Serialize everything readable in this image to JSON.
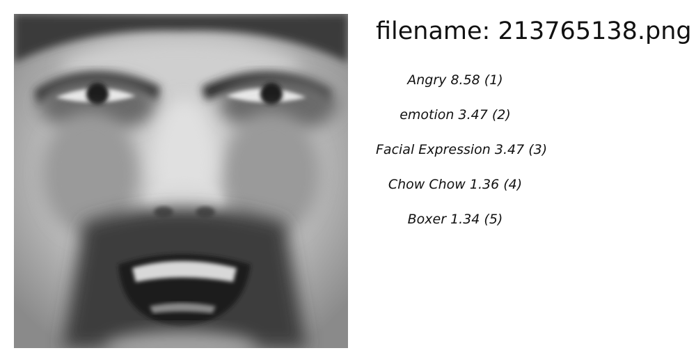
{
  "filename_text": "filename: 213765138.png",
  "labels": [
    {
      "text": "Angry  8.58 (1)"
    },
    {
      "text": "emotion  3.47 (2)"
    },
    {
      "text": "Facial Expression  3.47 (3)"
    },
    {
      "text": "Chow Chow  1.36 (4)"
    },
    {
      "text": "Boxer  1.34 (5)"
    }
  ]
}
